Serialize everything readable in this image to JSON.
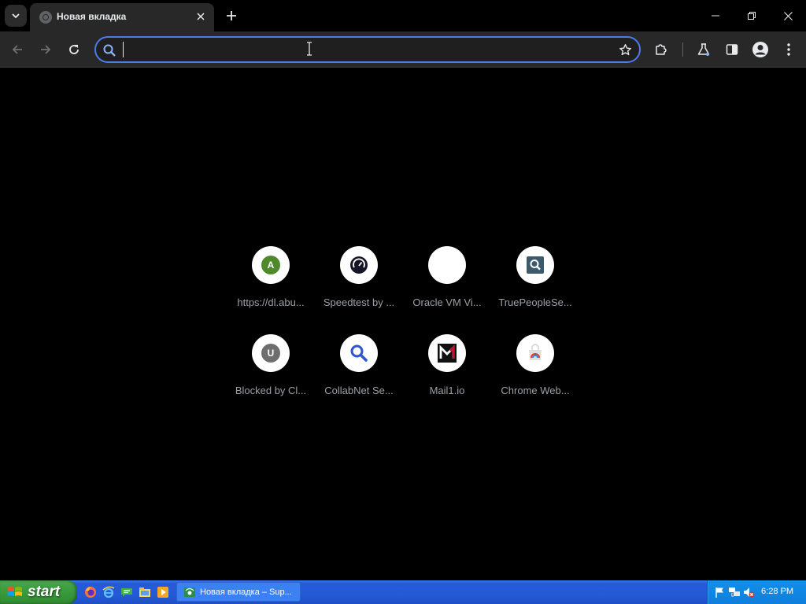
{
  "browser": {
    "tab": {
      "title": "Новая вкладка"
    },
    "omnibox": {
      "value": "",
      "placeholder": ""
    },
    "accent_color": "#4d7be8"
  },
  "new_tab_page": {
    "shortcuts": [
      {
        "label": "https://dl.abu...",
        "favicon": "letter-a-icon",
        "letter": "A",
        "color": "#4e8a2c"
      },
      {
        "label": "Speedtest by ...",
        "favicon": "speedtest-icon",
        "color": "#141526"
      },
      {
        "label": "Oracle VM Vi...",
        "favicon": "blank-icon",
        "color": "#ffffff"
      },
      {
        "label": "TruePeopleSe...",
        "favicon": "truepeople-search-icon",
        "color": "#3d5a6c"
      },
      {
        "label": "Blocked by Cl...",
        "favicon": "letter-u-icon",
        "letter": "U",
        "color": "#6e6e6e"
      },
      {
        "label": "CollabNet Se...",
        "favicon": "magnifier-icon",
        "color": "#2f55d4"
      },
      {
        "label": "Mail1.io",
        "favicon": "mail1-icon",
        "color": "#c8102e"
      },
      {
        "label": "Chrome Web...",
        "favicon": "chrome-web-store-icon",
        "color": "#e0e0e0"
      }
    ]
  },
  "taskbar": {
    "start_label": "start",
    "quick_launch": [
      "firefox-icon",
      "internet-explorer-icon",
      "messenger-icon",
      "folder-icon",
      "media-player-icon"
    ],
    "tasks": [
      {
        "label": "Новая вкладка – Sup..."
      }
    ],
    "tray": {
      "icons": [
        "flag-icon",
        "network-icon",
        "volume-muted-icon"
      ],
      "clock": "6:28 PM"
    }
  }
}
